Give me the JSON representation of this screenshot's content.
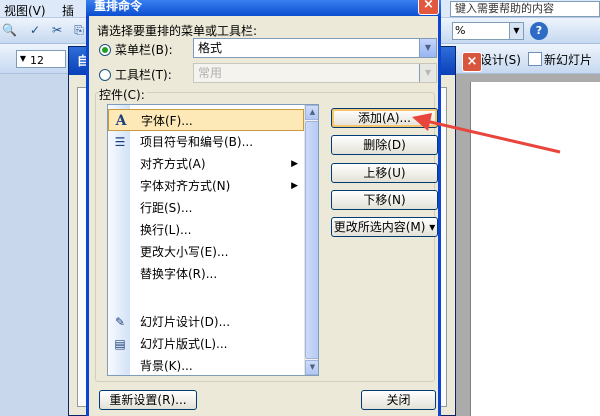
{
  "menubar": {
    "items": [
      "视图(V)",
      "插"
    ],
    "help_search": "键入需要帮助的内容"
  },
  "toolbar2": {
    "font_size": "12",
    "buttons": [
      "设计(S)",
      "新幻灯片"
    ]
  },
  "custom_dialog": {
    "title": "自"
  },
  "dialog": {
    "title": "重排命令",
    "close_glyph": "×",
    "prompt": "请选择要重排的菜单或工具栏:",
    "menubar_radio": {
      "label": "菜单栏(B):",
      "selected": true
    },
    "menubar_combo_value": "格式",
    "toolbar_radio": {
      "label": "工具栏(T):",
      "selected": false
    },
    "toolbar_combo_value": "常用",
    "controls_label": "控件(C):",
    "list_items": [
      {
        "icon": "font-A-icon",
        "glyph": "A",
        "label": "字体(F)...",
        "submenu": false,
        "selected": true
      },
      {
        "icon": "bullets-icon",
        "glyph": "☰",
        "label": "项目符号和编号(B)...",
        "submenu": false,
        "selected": false
      },
      {
        "icon": "",
        "glyph": "",
        "label": "对齐方式(A)",
        "submenu": true,
        "selected": false
      },
      {
        "icon": "",
        "glyph": "",
        "label": "字体对齐方式(N)",
        "submenu": true,
        "selected": false
      },
      {
        "icon": "",
        "glyph": "",
        "label": "行距(S)...",
        "submenu": false,
        "selected": false
      },
      {
        "icon": "",
        "glyph": "",
        "label": "换行(L)...",
        "submenu": false,
        "selected": false
      },
      {
        "icon": "",
        "glyph": "",
        "label": "更改大小写(E)...",
        "submenu": false,
        "selected": false
      },
      {
        "icon": "",
        "glyph": "",
        "label": "替换字体(R)...",
        "submenu": false,
        "selected": false
      },
      {
        "icon": "slide-design-icon",
        "glyph": "✎",
        "label": "幻灯片设计(D)...",
        "submenu": false,
        "selected": false
      },
      {
        "icon": "slide-layout-icon",
        "glyph": "▤",
        "label": "幻灯片版式(L)...",
        "submenu": false,
        "selected": false
      },
      {
        "icon": "",
        "glyph": "",
        "label": "背景(K)...",
        "submenu": false,
        "selected": false
      }
    ],
    "buttons": {
      "add": "添加(A)...",
      "delete": "删除(D)",
      "move_up": "上移(U)",
      "move_down": "下移(N)",
      "modify": "更改所选内容(M) ▾",
      "reset": "重新设置(R)...",
      "close": "关闭"
    }
  },
  "annotation_color": "#e8453c"
}
